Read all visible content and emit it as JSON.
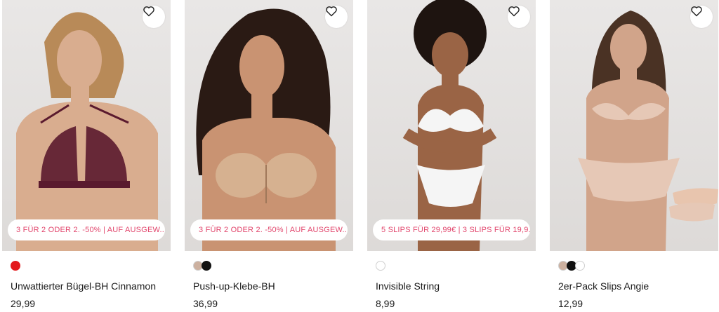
{
  "products": [
    {
      "name": "Unwattierter Bügel-BH Cinnamon",
      "price": "29,99",
      "promo": "3 FÜR 2 ODER 2. -50% | AUF AUSGEW...",
      "swatches": [
        "#e3191c"
      ],
      "garment_color": "#5a1a2e",
      "skin": "#d9ad8f"
    },
    {
      "name": "Push-up-Klebe-BH",
      "price": "36,99",
      "promo": "3 FÜR 2 ODER 2. -50% | AUF AUSGEW...",
      "swatches": [
        "#cdb1a0",
        "#111111"
      ],
      "garment_color": "#d6b190",
      "skin": "#c99372"
    },
    {
      "name": "Invisible String",
      "price": "8,99",
      "promo": "5 SLIPS FÜR 29,99€ | 3 SLIPS FÜR 19,9...",
      "swatches": [
        "#ffffff"
      ],
      "garment_color": "#f5f5f5",
      "skin": "#9a6445"
    },
    {
      "name": "2er-Pack Slips Angie",
      "price": "12,99",
      "promo": "",
      "swatches": [
        "#cdb1a0",
        "#111111",
        "#ffffff"
      ],
      "garment_color": "#e6c8b6",
      "skin": "#d1a48a"
    }
  ],
  "colors": {
    "promo_text": "#e2476d",
    "background": "#ffffff",
    "image_bg": "#e4e2e1"
  },
  "icons": {
    "wishlist": "heart-icon"
  }
}
